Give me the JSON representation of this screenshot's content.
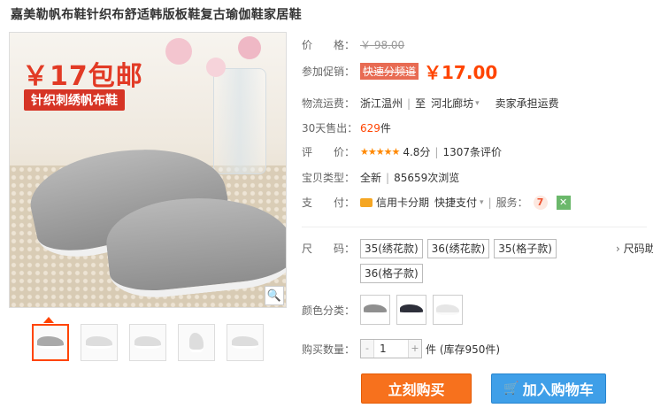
{
  "title": "嘉美勒帆布鞋针织布舒适韩版板鞋复古瑜伽鞋家居鞋",
  "image": {
    "promo_big": "￥17包邮",
    "promo_small": "针织刺绣帆布鞋",
    "thumbs": [
      "thumb-1",
      "thumb-2",
      "thumb-3",
      "thumb-4",
      "thumb-5"
    ]
  },
  "price": {
    "label": "价　　格：",
    "original": "￥ 98.00"
  },
  "promo": {
    "label": "参加促销：",
    "tag": "快速分频道",
    "price": "￥17.00"
  },
  "shipping": {
    "label": "物流运费：",
    "from": "浙江温州",
    "to_label": "至",
    "to": "河北廊坊",
    "note": "卖家承担运费"
  },
  "sales": {
    "label": "30天售出：",
    "count": "629",
    "unit": "件"
  },
  "rating": {
    "label": "评　　价：",
    "stars": "★★★★★",
    "score": "4.8分",
    "reviews": "1307条评价"
  },
  "type": {
    "label": "宝贝类型：",
    "value": "全新",
    "views": "85659次浏览"
  },
  "payment": {
    "label": "支　　付：",
    "card": "信用卡分期",
    "quick": "快捷支付",
    "service_label": "服务："
  },
  "size": {
    "label": "尺　　码：",
    "options": [
      "35(绣花款)",
      "36(绣花款)",
      "35(格子款)",
      "36(格子款)"
    ],
    "chart_link": "尺码助"
  },
  "color": {
    "label": "颜色分类："
  },
  "quantity": {
    "label": "购买数量：",
    "value": "1",
    "stock": "件 (库存950件)"
  },
  "buttons": {
    "buy": "立刻购买",
    "cart": "加入购物车"
  },
  "colors": {
    "accent": "#ff4400",
    "buy_bg": "#f7711d",
    "cart_bg": "#3f9fe8"
  }
}
